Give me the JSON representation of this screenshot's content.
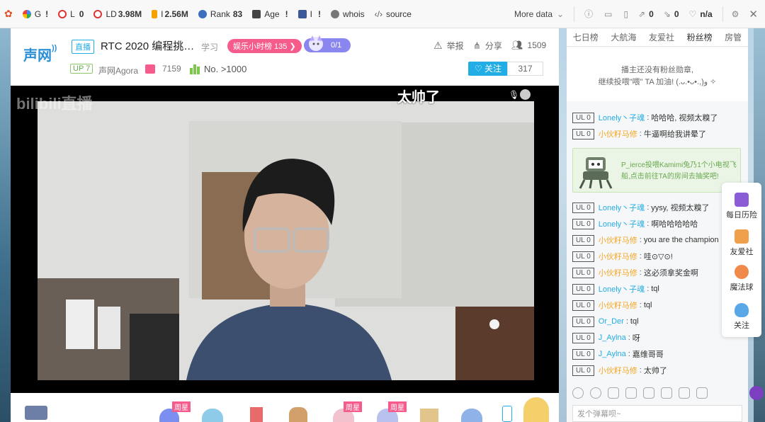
{
  "seo": {
    "items": [
      {
        "name": "google",
        "icon": "google-icon",
        "label": "G",
        "value": "!"
      },
      {
        "name": "l",
        "icon": "circle-icon",
        "label": "L",
        "value": "0"
      },
      {
        "name": "ld",
        "icon": "circle-icon",
        "label": "LD",
        "value": "3.98M"
      },
      {
        "name": "bing",
        "icon": "bing-icon",
        "label": "I",
        "value": "2.56M"
      },
      {
        "name": "rank",
        "icon": "globe-icon",
        "label": "Rank",
        "value": "83"
      },
      {
        "name": "age",
        "icon": "calendar-icon",
        "label": "Age",
        "value": "!"
      },
      {
        "name": "facebook",
        "icon": "facebook-icon",
        "label": "I",
        "value": "!"
      },
      {
        "name": "whois",
        "icon": "person-icon",
        "label": "whois",
        "value": ""
      },
      {
        "name": "source",
        "icon": "code-icon",
        "label": "source",
        "value": ""
      }
    ],
    "more": "More data",
    "right": [
      "0",
      "0",
      "n/a"
    ]
  },
  "room": {
    "logo": "声网",
    "live_tag": "直播",
    "title": "RTC 2020 编程挑…",
    "category": "学习",
    "rank_pill": "娱乐小时榜 135",
    "ava_count": "0/1",
    "report": "举报",
    "share": "分享",
    "viewers": "1509",
    "up_level": "UP 7",
    "anchor": "声网Agora",
    "gifts": "7159",
    "rank_no": "No. >1000",
    "follow": "关注",
    "follow_count": "317",
    "danmaku": "太帅了",
    "watermark": "bilibili直播"
  },
  "gift_bar": {
    "badge1": "周星",
    "badge2": "周星",
    "badge3": "周星"
  },
  "right_panel": {
    "tabs": [
      "七日榜",
      "大航海",
      "友爱社",
      "粉丝榜",
      "房管"
    ],
    "active_tab": 3,
    "fan_line1": "播主还没有粉丝勋章,",
    "fan_line2": "继续投喂\"喂\" TA 加油! (.ᴗ.•ᴗ•.,)ﻭ ✧",
    "gift_notice": "P_ierce投喂Kamimi兔乃1个小电视飞船,点击前往TA的房间去抽奖吧!",
    "input_placeholder": "发个弹幕呗~",
    "messages": [
      {
        "lvl": "UL 0",
        "nick": "Lonely丶子魂",
        "orange": false,
        "text": "哈哈哈, 视频太糗了"
      },
      {
        "lvl": "UL 0",
        "nick": "小伙籽马修",
        "orange": true,
        "text": "牛逼啊给我讲晕了"
      },
      {
        "lvl": "UL 0",
        "nick": "Lonely丶子魂",
        "orange": false,
        "text": "yysy, 视频太糗了"
      },
      {
        "lvl": "UL 0",
        "nick": "Lonely丶子魂",
        "orange": false,
        "text": "啊哈哈哈哈哈"
      },
      {
        "lvl": "UL 0",
        "nick": "小伙籽马修",
        "orange": true,
        "text": "you are the champion"
      },
      {
        "lvl": "UL 0",
        "nick": "小伙籽马修",
        "orange": true,
        "text": "哇⊙▽⊙!"
      },
      {
        "lvl": "UL 0",
        "nick": "小伙籽马修",
        "orange": true,
        "text": "这必须拿奖金啊"
      },
      {
        "lvl": "UL 0",
        "nick": "Lonely丶子魂",
        "orange": false,
        "text": "tql"
      },
      {
        "lvl": "UL 0",
        "nick": "小伙籽马修",
        "orange": true,
        "text": "tql"
      },
      {
        "lvl": "UL 0",
        "nick": "Or_Der",
        "orange": false,
        "text": "tql"
      },
      {
        "lvl": "UL 0",
        "nick": "J_Aylna",
        "orange": false,
        "text": "呀"
      },
      {
        "lvl": "UL 0",
        "nick": "J_Aylna",
        "orange": false,
        "text": "嘉维哥哥"
      },
      {
        "lvl": "UL 0",
        "nick": "小伙籽马修",
        "orange": true,
        "text": "太帅了"
      }
    ]
  },
  "side_menu": [
    "每日历险",
    "友爱社",
    "魔法球",
    "关注"
  ],
  "colors": {
    "accent": "#23ade5",
    "pink": "#f55c8b",
    "nick_orange": "#f5a623"
  }
}
